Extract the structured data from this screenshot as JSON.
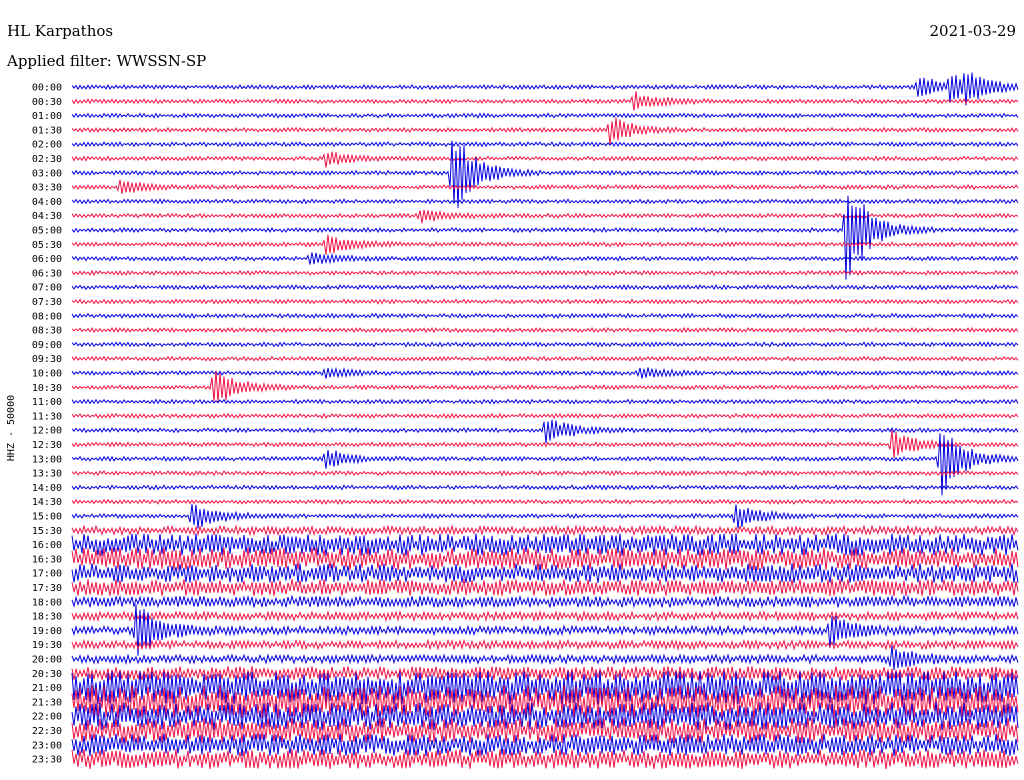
{
  "header": {
    "station": "HL Karpathos",
    "filter": "Applied filter: WWSSN-SP",
    "date": "2021-03-29"
  },
  "chart_data": {
    "type": "line",
    "title": "HL Karpathos",
    "subtitle": "Applied filter: WWSSN-SP",
    "ylabel": "HHZ - 50000",
    "rows": [
      "00:00",
      "00:30",
      "01:00",
      "01:30",
      "02:00",
      "02:30",
      "03:00",
      "03:30",
      "04:00",
      "04:30",
      "05:00",
      "05:30",
      "06:00",
      "06:30",
      "07:00",
      "07:30",
      "08:00",
      "08:30",
      "09:00",
      "09:30",
      "10:00",
      "10:30",
      "11:00",
      "11:30",
      "12:00",
      "12:30",
      "13:00",
      "13:30",
      "14:00",
      "14:30",
      "15:00",
      "15:30",
      "16:00",
      "16:30",
      "17:00",
      "17:30",
      "18:00",
      "18:30",
      "19:00",
      "19:30",
      "20:00",
      "20:30",
      "21:00",
      "21:30",
      "22:00",
      "22:30",
      "23:00",
      "23:30"
    ],
    "trace_colors": [
      "#0000dd",
      "#ee1144"
    ],
    "noise_level": [
      1.5,
      1.5,
      1.5,
      1.5,
      1.5,
      1.5,
      1.5,
      1.5,
      1.5,
      1.5,
      1.5,
      1.5,
      1.5,
      1.5,
      1.5,
      1.5,
      1.5,
      1.5,
      1.5,
      1.5,
      1.5,
      1.5,
      1.5,
      1.5,
      1.5,
      1.5,
      1.5,
      1.5,
      1.5,
      1.5,
      1.5,
      3,
      8,
      8,
      7,
      6,
      4,
      3,
      3,
      3,
      3,
      5,
      12,
      12,
      10,
      9,
      8,
      7
    ],
    "events": [
      {
        "row": 0,
        "minute": 28.3,
        "amp": 14
      },
      {
        "row": 0,
        "minute": 27.8,
        "amp": 14
      },
      {
        "row": 1,
        "minute": 17.8,
        "amp": 10
      },
      {
        "row": 0,
        "minute": 26.8,
        "amp": 12
      },
      {
        "row": 3,
        "minute": 17.0,
        "amp": 16
      },
      {
        "row": 6,
        "minute": 12.0,
        "amp": 50
      },
      {
        "row": 10,
        "minute": 24.5,
        "amp": 60
      },
      {
        "row": 11,
        "minute": 8.0,
        "amp": 12
      },
      {
        "row": 5,
        "minute": 8.0,
        "amp": 8
      },
      {
        "row": 7,
        "minute": 1.5,
        "amp": 8
      },
      {
        "row": 9,
        "minute": 11.0,
        "amp": 8
      },
      {
        "row": 12,
        "minute": 7.5,
        "amp": 8
      },
      {
        "row": 21,
        "minute": 4.5,
        "amp": 22
      },
      {
        "row": 20,
        "minute": 8.0,
        "amp": 6
      },
      {
        "row": 20,
        "minute": 18.0,
        "amp": 6
      },
      {
        "row": 24,
        "minute": 15.0,
        "amp": 16
      },
      {
        "row": 25,
        "minute": 26.0,
        "amp": 14
      },
      {
        "row": 26,
        "minute": 27.5,
        "amp": 40
      },
      {
        "row": 26,
        "minute": 8.0,
        "amp": 12
      },
      {
        "row": 30,
        "minute": 3.8,
        "amp": 16
      },
      {
        "row": 30,
        "minute": 21.0,
        "amp": 14
      },
      {
        "row": 38,
        "minute": 2.0,
        "amp": 30
      },
      {
        "row": 38,
        "minute": 24.0,
        "amp": 16
      },
      {
        "row": 40,
        "minute": 26.0,
        "amp": 12
      }
    ]
  }
}
